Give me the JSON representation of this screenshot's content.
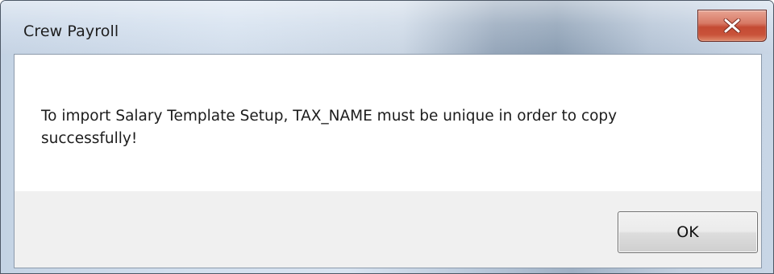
{
  "window": {
    "title": "Crew Payroll"
  },
  "titlebar": {
    "close_icon": "close-icon"
  },
  "dialog": {
    "message": "To import Salary Template Setup, TAX_NAME must be unique in order to copy\nsuccessfully!",
    "ok_label": "OK"
  },
  "colors": {
    "close_button": "#c9533a",
    "button_area": "#f0f0f0",
    "message_background": "#ffffff"
  }
}
